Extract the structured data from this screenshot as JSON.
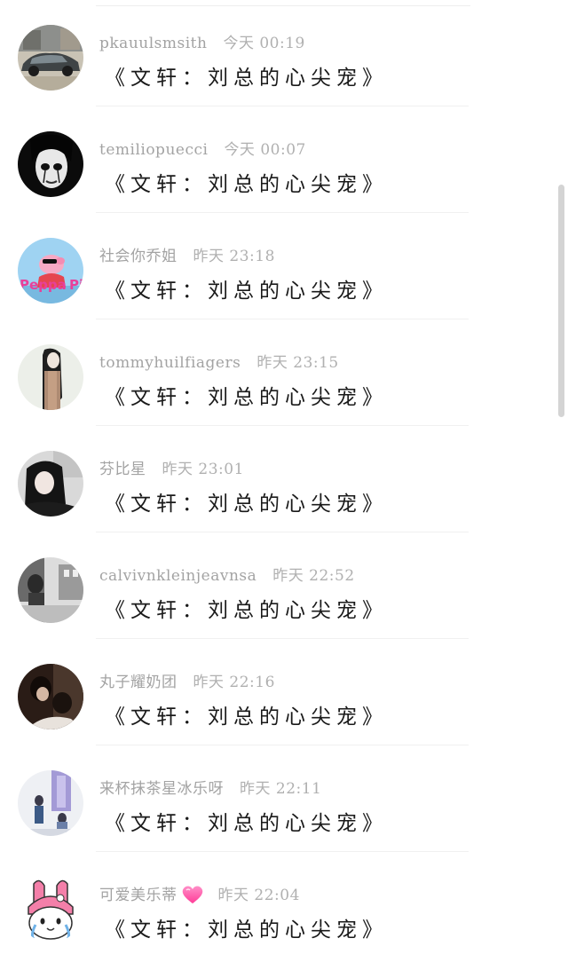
{
  "comments": [
    {
      "username": "pkauulsmsith",
      "time": "今天 00:19",
      "text": "《文轩：刘总的心尖宠》",
      "avatar": "car-photo-avatar"
    },
    {
      "username": "temiliopuecci",
      "time": "今天 00:07",
      "text": "《文轩：刘总的心尖宠》",
      "avatar": "dark-face-avatar"
    },
    {
      "username": "社会你乔姐",
      "time": "昨天 23:18",
      "text": "《文轩：刘总的心尖宠》",
      "avatar": "peppa-pig-avatar"
    },
    {
      "username": "tommyhuilfiagers",
      "time": "昨天 23:15",
      "text": "《文轩：刘总的心尖宠》",
      "avatar": "woman-portrait-avatar"
    },
    {
      "username": "芬比星",
      "time": "昨天 23:01",
      "text": "《文轩：刘总的心尖宠》",
      "avatar": "girl-photo-avatar"
    },
    {
      "username": "calvivnkleinjeavnsa",
      "time": "昨天 22:52",
      "text": "《文轩：刘总的心尖宠》",
      "avatar": "street-photo-avatar"
    },
    {
      "username": "丸子耀奶团",
      "time": "昨天 22:16",
      "text": "《文轩：刘总的心尖宠》",
      "avatar": "couple-photo-avatar"
    },
    {
      "username": "来杯抹茶星冰乐呀",
      "time": "昨天 22:11",
      "text": "《文轩：刘总的心尖宠》",
      "avatar": "illustration-avatar"
    },
    {
      "username": "可爱美乐蒂",
      "time": "昨天 22:04",
      "text": "《文轩：刘总的心尖宠》",
      "avatar": "my-melody-avatar",
      "name_emoji": "pink-heart-icon"
    }
  ],
  "colors": {
    "meta_text": "#a7a7a7",
    "comment_text": "#1a1a1a",
    "divider": "#f0f0f0",
    "scrollbar": "#d4d4d4",
    "heart": "#ff4fa3"
  }
}
